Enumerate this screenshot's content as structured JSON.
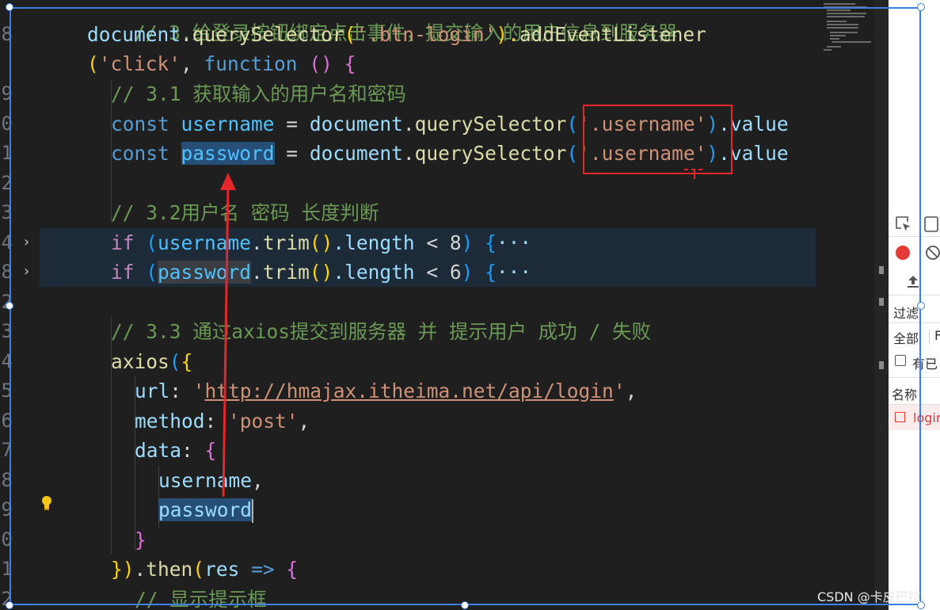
{
  "editor": {
    "line_numbers": [
      "8",
      "9",
      "0",
      "1",
      "2",
      "3",
      "4",
      "8",
      "2",
      "3",
      "4",
      "5",
      "6",
      "7",
      "8",
      "9",
      "0",
      "1",
      "2"
    ],
    "lines": {
      "l0_comment": "// 3.给登录按钮绑定点击事件，提交输入的用户信息到服务器",
      "l1": {
        "a": "document",
        "b": ".",
        "c": "querySelector",
        "d": "(",
        "e": "'.btn-login'",
        "f": ").",
        "g": "addEventListener"
      },
      "l2": {
        "a": "(",
        "b": "'click'",
        "c": ", ",
        "d": "function",
        "e": " () ",
        "f": "{"
      },
      "l3_comment": "// 3.1 获取输入的用户名和密码",
      "l4": {
        "kw": "const",
        "var": "username",
        "eq": " = ",
        "obj": "document",
        "dot": ".",
        "fn": "querySelector",
        "open": "(",
        "str": "'.username'",
        "close": ")",
        "prop": ".value"
      },
      "l5": {
        "kw": "const",
        "var": "password",
        "eq": " = ",
        "obj": "document",
        "dot": ".",
        "fn": "querySelector",
        "open": "(",
        "str": "'.username'",
        "close": ")",
        "prop": ".value"
      },
      "l7_comment": "// 3.2用户名 密码 长度判断",
      "l8": {
        "kw": "if",
        "open": " (",
        "var": "username",
        "dot": ".",
        "fn": "trim",
        "call": "()",
        "prop": ".length",
        "op": " < ",
        "num": "8",
        "close": ") ",
        "brace": "{",
        "ellipsis": "···"
      },
      "l9": {
        "kw": "if",
        "open": " (",
        "var": "password",
        "dot": ".",
        "fn": "trim",
        "call": "()",
        "prop": ".length",
        "op": " < ",
        "num": "6",
        "close": ") ",
        "brace": "{",
        "ellipsis": "···"
      },
      "l11_comment": "// 3.3 通过axios提交到服务器 并 提示用户 成功 / 失败",
      "l12": {
        "fn": "axios",
        "open": "(",
        "brace": "{"
      },
      "l13": {
        "key": "url",
        "colon": ": ",
        "q1": "'",
        "url": "http://hmajax.itheima.net/api/login",
        "q2": "'",
        "comma": ","
      },
      "l14": {
        "key": "method",
        "colon": ": ",
        "str": "'post'",
        "comma": ","
      },
      "l15": {
        "key": "data",
        "colon": ": ",
        "brace": "{"
      },
      "l16": {
        "var": "username",
        "comma": ","
      },
      "l17": {
        "var": "password"
      },
      "l18": {
        "brace": "}"
      },
      "l19": {
        "close": "})",
        "dot": ".",
        "fn": "then",
        "open": "(",
        "arg": "res",
        "arrow": " => ",
        "brace": "{"
      },
      "l20_comment": "// 显示提示框"
    }
  },
  "devtools": {
    "filter_label": "过滤",
    "all_label": "全部",
    "cut_label": "F",
    "preserve_label": "有已",
    "name_header": "名称",
    "request_name": "login"
  },
  "watermark": "CSDN @卡皮巴拉",
  "colors": {
    "annotation_red": "#e5262a",
    "selection_blue": "#3d7fe6",
    "record_red": "#e53935"
  }
}
